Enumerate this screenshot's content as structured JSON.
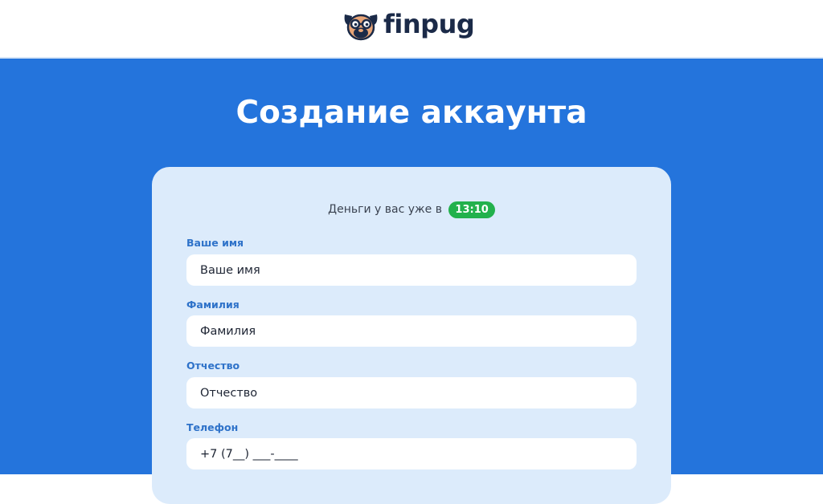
{
  "header": {
    "logo_text": "finpug",
    "logo_icon": "pug-with-glasses-icon"
  },
  "page": {
    "title": "Создание аккаунта"
  },
  "form": {
    "timer_text": "Деньги у вас уже в",
    "timer_value": "13:10",
    "fields": [
      {
        "label": "Ваше имя",
        "placeholder": "Ваше имя",
        "value": ""
      },
      {
        "label": "Фамилия",
        "placeholder": "Фамилия",
        "value": ""
      },
      {
        "label": "Отчество",
        "placeholder": "Отчество",
        "value": ""
      },
      {
        "label": "Телефон",
        "placeholder": "+7 (7__) ___-____",
        "value": ""
      }
    ]
  },
  "colors": {
    "brand_blue": "#2474dc",
    "card_bg": "#dcebfb",
    "label_blue": "#2e72c9",
    "timer_green": "#22b14c",
    "logo_dark": "#1b2a48",
    "pug_tan": "#e8a577"
  }
}
